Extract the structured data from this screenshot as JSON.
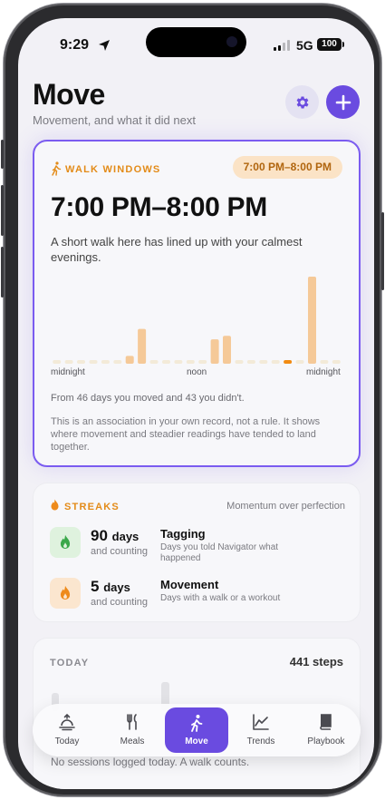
{
  "status_bar": {
    "time": "9:29",
    "network": "5G",
    "battery": "100"
  },
  "header": {
    "title": "Move",
    "subtitle": "Movement, and what it did next"
  },
  "walk_windows": {
    "eyebrow": "WALK WINDOWS",
    "pill": "7:00 PM–8:00 PM",
    "window": "7:00 PM–8:00 PM",
    "description": "A short walk here has lined up with your calmest evenings.",
    "axis": {
      "start": "midnight",
      "mid": "noon",
      "end": "midnight"
    },
    "stat": "From 46 days you moved and 43 you didn't.",
    "note": "This is an association in your own record, not a rule. It shows where movement and steadier readings have tended to land together.",
    "colors": {
      "accent": "#e38b18",
      "highlight": "#f28b12",
      "bar": "#f5c998",
      "empty": "#f3ead8"
    }
  },
  "chart_data": {
    "type": "bar",
    "categories": [
      "0",
      "1",
      "2",
      "3",
      "4",
      "5",
      "6",
      "7",
      "8",
      "9",
      "10",
      "11",
      "12",
      "13",
      "14",
      "15",
      "16",
      "17",
      "18",
      "19",
      "20",
      "21",
      "22",
      "23"
    ],
    "values": [
      0.04,
      0.04,
      0.04,
      0.04,
      0.04,
      0.04,
      0.09,
      0.4,
      0.04,
      0.04,
      0.04,
      0.04,
      0.04,
      0.28,
      0.32,
      0.04,
      0.04,
      0.04,
      0.04,
      0.04,
      0.04,
      1.0,
      0.04,
      0.04
    ],
    "highlight_index": 19,
    "xlabel": "",
    "ylabel": ""
  },
  "streaks": {
    "eyebrow": "STREAKS",
    "tagline": "Momentum over perfection",
    "items": [
      {
        "count": "90",
        "unit": "days",
        "sub": "and counting",
        "label": "Tagging",
        "desc": "Days you told Navigator what happened",
        "icon": "flame-icon",
        "color": "#3aa84a",
        "tile": "#dff2de"
      },
      {
        "count": "5",
        "unit": "days",
        "sub": "and counting",
        "label": "Movement",
        "desc": "Days with a walk or a workout",
        "icon": "flame-icon",
        "color": "#ee8a1a",
        "tile": "#fbe6cf"
      }
    ]
  },
  "today": {
    "eyebrow": "TODAY",
    "steps": "441 steps",
    "empty": "No sessions logged today. A walk counts."
  },
  "tabs": [
    {
      "label": "Today",
      "icon": "sunrise-icon"
    },
    {
      "label": "Meals",
      "icon": "fork-knife-icon"
    },
    {
      "label": "Move",
      "icon": "walking-icon",
      "active": true
    },
    {
      "label": "Trends",
      "icon": "chart-icon"
    },
    {
      "label": "Playbook",
      "icon": "book-icon"
    }
  ]
}
